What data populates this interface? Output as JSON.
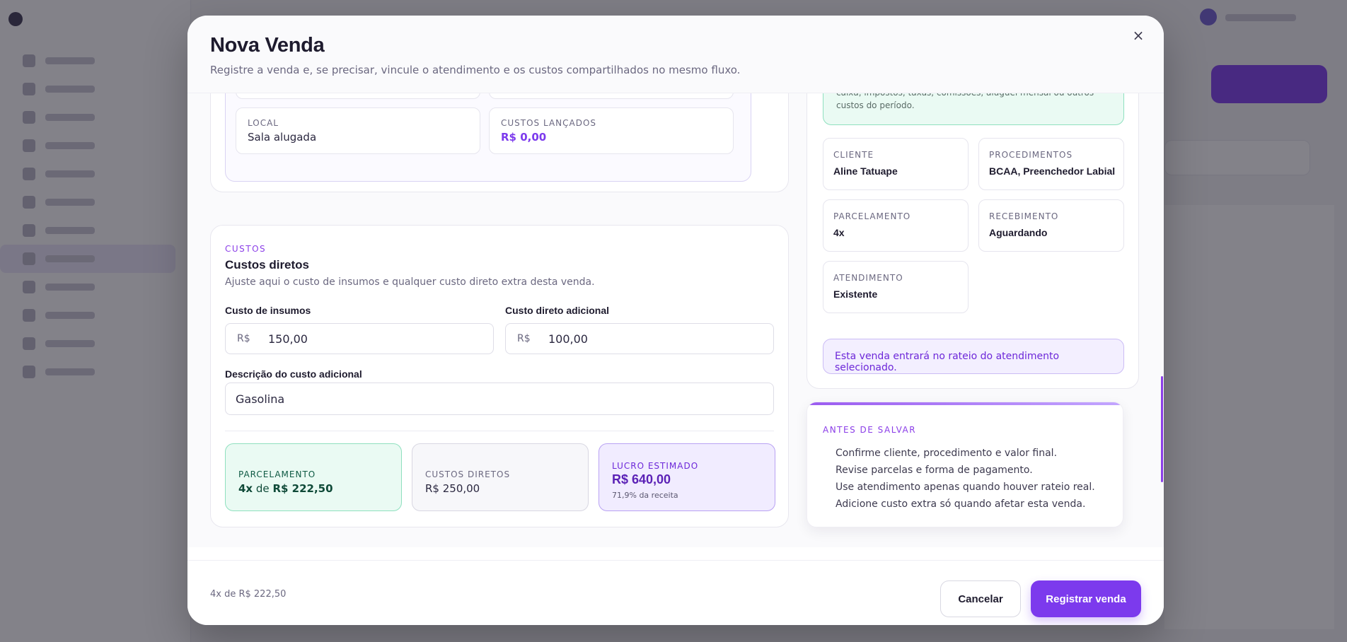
{
  "modal": {
    "title": "Nova Venda",
    "subtitle": "Registre a venda e, se precisar, vincule o atendimento e os custos compartilhados no mesmo fluxo.",
    "close_label": "×"
  },
  "atendimento_card": {
    "local_label": "LOCAL",
    "local_value": "Sala alugada",
    "custos_label": "CUSTOS LANÇADOS",
    "custos_value": "R$ 0,00"
  },
  "custos": {
    "eyebrow": "CUSTOS",
    "title": "Custos diretos",
    "description": "Ajuste aqui o custo de insumos e qualquer custo direto extra desta venda.",
    "insumos_label": "Custo de insumos",
    "insumos_prefix": "R$",
    "insumos_value": "150,00",
    "adicional_label": "Custo direto adicional",
    "adicional_prefix": "R$",
    "adicional_value": "100,00",
    "descricao_label": "Descrição do custo adicional",
    "descricao_value": "Gasolina"
  },
  "stats": {
    "parcelamento_label": "PARCELAMENTO",
    "parcelamento_count": "4x",
    "parcelamento_de": "de",
    "parcelamento_amount": "R$ 222,50",
    "custos_label": "CUSTOS DIRETOS",
    "custos_value": "R$ 250,00",
    "lucro_label": "LUCRO ESTIMADO",
    "lucro_value": "R$ 640,00",
    "lucro_sub": "71,9% da receita"
  },
  "resumo": {
    "note": "caixa, impostos, taxas, comissões, aluguel mensal ou outros custos do período.",
    "cliente_label": "CLIENTE",
    "cliente_value": "Aline Tatuape",
    "procedimentos_label": "PROCEDIMENTOS",
    "procedimentos_value": "BCAA, Preenchedor Labial",
    "parcelamento_label": "PARCELAMENTO",
    "parcelamento_value": "4x",
    "recebimento_label": "RECEBIMENTO",
    "recebimento_value": "Aguardando",
    "atendimento_label": "ATENDIMENTO",
    "atendimento_value": "Existente",
    "rateio_note": "Esta venda entrará no rateio do atendimento selecionado."
  },
  "checklist": {
    "eyebrow": "ANTES DE SALVAR",
    "items": [
      "Confirme cliente, procedimento e valor final.",
      "Revise parcelas e forma de pagamento.",
      "Use atendimento apenas quando houver rateio real.",
      "Adicione custo extra só quando afetar esta venda."
    ]
  },
  "footer": {
    "summary": "4x de R$ 222,50",
    "cancel_label": "Cancelar",
    "submit_label": "Registrar venda"
  },
  "colors": {
    "accent": "#7c3aed",
    "success_bg": "#eafaf3",
    "violet_bg": "#f1ecff"
  }
}
